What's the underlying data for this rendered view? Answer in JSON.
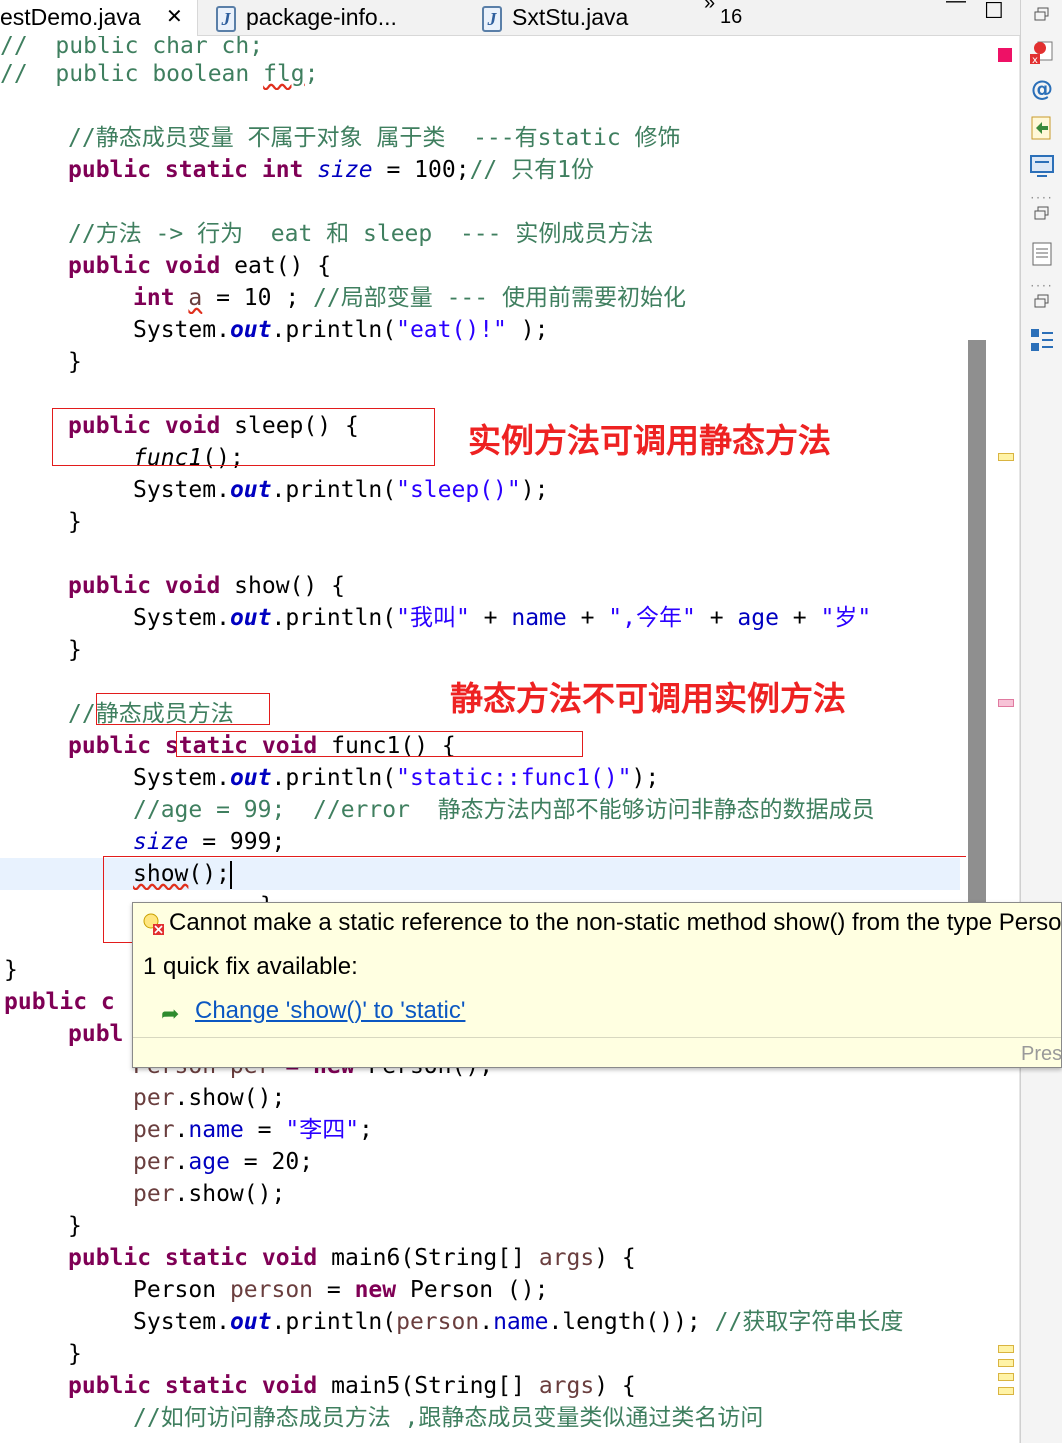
{
  "tabs": [
    {
      "label": "estDemo.java",
      "close_glyph": "✕"
    },
    {
      "label": "package-info...",
      "icon": "J"
    },
    {
      "label": "SxtStu.java",
      "icon": "J"
    }
  ],
  "overflow": {
    "glyph": "»",
    "count": "16"
  },
  "window_buttons": {
    "minimize": "—",
    "maximize": "☐"
  },
  "code": {
    "l0": {
      "a": "//  ",
      "b": "public char ch;"
    },
    "l1": {
      "a": "//  ",
      "b": "public boolean ",
      "c": "flg",
      "d": ";"
    },
    "l3": {
      "a": "//静态成员变量 不属于对象 属于类  ---有static 修饰"
    },
    "l4": {
      "kw": "public static int ",
      "f": "size",
      "r": " = 100;",
      "c": "// 只有1份"
    },
    "l6": {
      "a": "//方法 -> 行为  eat 和 sleep  --- 实例成员方法"
    },
    "l7": {
      "kw": "public void ",
      "r": "eat() {"
    },
    "l8": {
      "kw": "int ",
      "v": "a",
      "r": " = 10 ; ",
      "c": "//局部变量 --- 使用前需要初始化"
    },
    "l9": {
      "a": "System.",
      "o": "out",
      "b": ".println(",
      "s": "\"eat()!\"",
      "r": " );"
    },
    "l10": {
      "r": "}"
    },
    "l12": {
      "kw": "public void ",
      "r": "sleep() {"
    },
    "l13": {
      "i": "func1",
      "r": "();"
    },
    "l14": {
      "a": "System.",
      "o": "out",
      "b": ".println(",
      "s": "\"sleep()\"",
      "r": ");"
    },
    "l15": {
      "r": "}"
    },
    "l17": {
      "kw": "public void ",
      "r": "show() {"
    },
    "l18": {
      "a": "System.",
      "o": "out",
      "b": ".println(",
      "s1": "\"我叫\"",
      "p1": " + ",
      "f1": "name",
      "p2": " + ",
      "s2": "\",今年\"",
      "p3": " + ",
      "f2": "age",
      "p4": " + ",
      "s3": "\"岁\""
    },
    "l19": {
      "r": "}"
    },
    "l21": {
      "a": "//静态成员方法"
    },
    "l22": {
      "kw": "public static void ",
      "r": "func1() {"
    },
    "l23": {
      "a": "System.",
      "o": "out",
      "b": ".println(",
      "s": "\"static::func1()\"",
      "r": ");"
    },
    "l24": {
      "c": "//age = 99;  //error  静态方法内部不能够访问非静态的数据成员"
    },
    "l25": {
      "f": "size",
      "r": " = 999;"
    },
    "l26": {
      "sq": "show",
      "r": "();"
    },
    "l27": {
      "r": "}"
    },
    "l29": {
      "r": "}"
    },
    "l30": {
      "kw": "public c"
    },
    "l31": {
      "kw": "publ"
    },
    "l32": {
      "v": "Person per",
      "kw": " = new ",
      "r": "Person();"
    },
    "l33": {
      "v": "per",
      "r": ".show();"
    },
    "l34": {
      "v": "per",
      "p": ".",
      "f": "name",
      "r": " = ",
      "s": "\"李四\"",
      "e": ";"
    },
    "l35": {
      "v": "per",
      "p": ".",
      "f": "age",
      "r": " = 20;"
    },
    "l36": {
      "v": "per",
      "r": ".show();"
    },
    "l37": {
      "r": "}"
    },
    "l38": {
      "kw": "public static void ",
      "r": "main6(String[] ",
      "v": "args",
      "e": ") {"
    },
    "l39": {
      "r": "Person ",
      "v": "person",
      "m": " = ",
      "kw": "new ",
      "e": "Person ();"
    },
    "l40": {
      "a": "System.",
      "o": "out",
      "b": ".println(",
      "v": "person",
      "p": ".",
      "f": "name",
      "r": ".length()); ",
      "c": "//获取字符串长度"
    },
    "l41": {
      "r": "}"
    },
    "l42": {
      "kw": "public static void ",
      "r": "main5(String[] ",
      "v": "args",
      "e": ") {"
    },
    "l43": {
      "c": "//如何访问静态成员方法 ,跟静态成员变量类似通过类名访问"
    }
  },
  "annotations": {
    "note1": "实例方法可调用静态方法",
    "note2": "静态方法不可调用实例方法"
  },
  "popup": {
    "message": "Cannot make a static reference to the non-static method show() from the type Person",
    "quick_fix_count": "1 quick fix available:",
    "fix_label": "Change 'show()' to 'static'",
    "footer": "Press 'Tab' from proposal table or click for focus"
  },
  "colors": {
    "keyword": "#7f0055",
    "comment": "#3f7f5f",
    "string": "#2a00ff",
    "field": "#0000c0",
    "annotation": "#ee2222",
    "popup_bg": "#ffffe1"
  },
  "icons": [
    "restore-icon",
    "error-marker-icon",
    "javadoc-at-icon",
    "declaration-icon",
    "console-icon",
    "outline-icon",
    "hierarchy-icon"
  ]
}
